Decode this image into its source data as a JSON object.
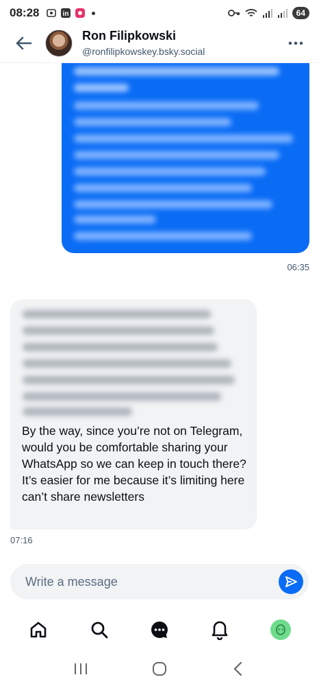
{
  "status_bar": {
    "time": "08:28",
    "battery": "64"
  },
  "header": {
    "name": "Ron Filipkowski",
    "handle": "@ronfilipkowskey.bsky.social"
  },
  "messages": [
    {
      "direction": "outgoing",
      "blurred": true,
      "time": "06:35"
    },
    {
      "direction": "incoming",
      "blurred_prefix": true,
      "visible_text": "By the way, since you’re not on Telegram, would you be comfortable sharing your WhatsApp so we can keep in touch there? It’s easier for me because it’s limiting here can’t share newsletters",
      "time": "07:16"
    }
  ],
  "composer": {
    "placeholder": "Write a message"
  },
  "tabs": [
    "home-icon",
    "search-icon",
    "chat-icon",
    "bell-icon",
    "profile-avatar"
  ],
  "colors": {
    "accent": "#0a6cf5",
    "incoming_bubble": "#f1f3f5",
    "muted_text": "#42576c",
    "profile_avatar": "#6fdc8c"
  }
}
